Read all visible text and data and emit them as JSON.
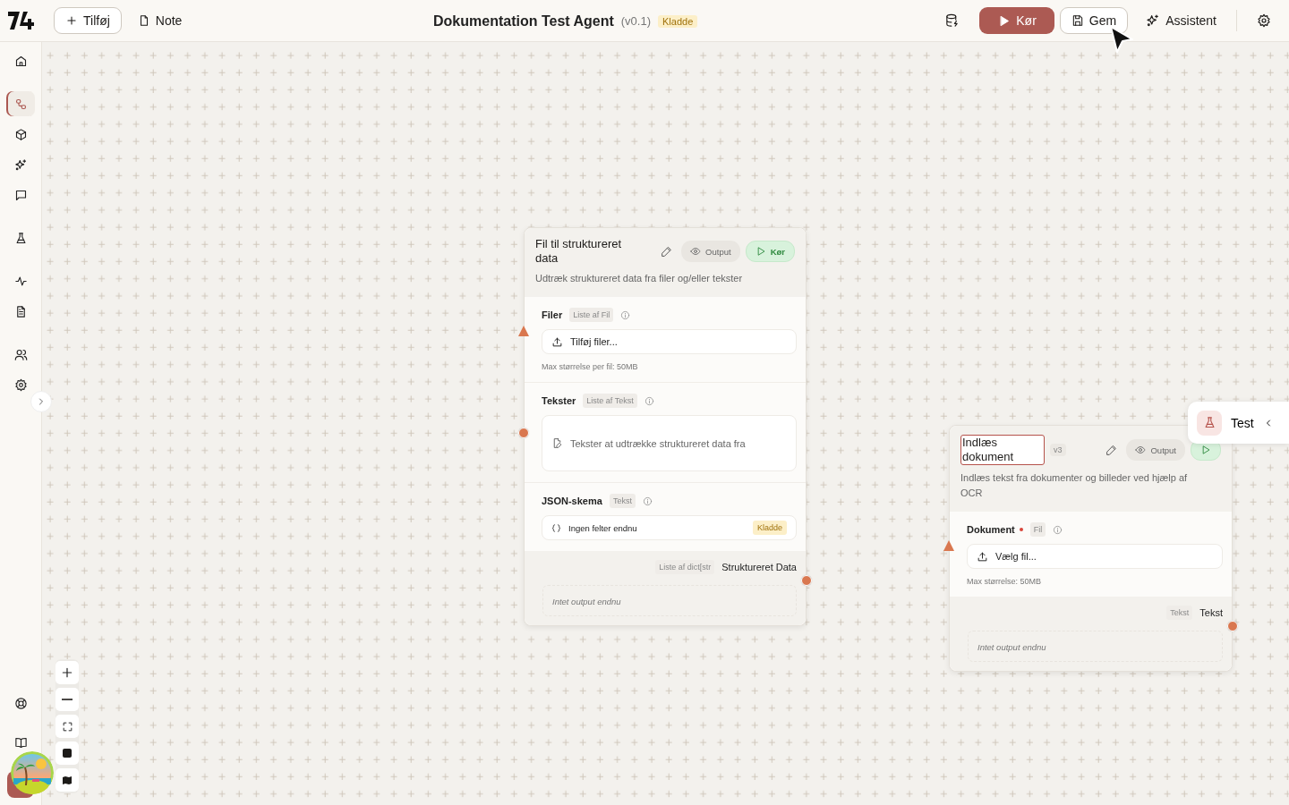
{
  "topbar": {
    "add_button": "Tilføj",
    "note_button": "Note",
    "title": "Dokumentation Test Agent",
    "version": "(v0.1)",
    "status_badge": "Kladde",
    "run_button": "Kør",
    "save_button": "Gem",
    "assistant_button": "Assistent"
  },
  "sidebar": {
    "items": [
      {
        "selected": false
      },
      {
        "selected": true
      },
      {
        "selected": false
      },
      {
        "selected": false
      },
      {
        "selected": false
      },
      {
        "selected": false
      },
      {
        "selected": false
      },
      {
        "selected": false
      },
      {
        "selected": false
      },
      {
        "selected": false
      }
    ]
  },
  "nodes": [
    {
      "title": "Fil til struktureret data",
      "editing": false,
      "description": "Udtræk struktureret data fra filer og/eller tekster",
      "output_button": "Output",
      "run_button": "Kør",
      "inputs": [
        {
          "kind": "upload",
          "label": "Filer",
          "required": false,
          "type": "Liste af Fil",
          "button": "Tilføj filer...",
          "hint": "Max størrelse per fil: 50MB"
        },
        {
          "kind": "text",
          "label": "Tekster",
          "required": false,
          "type": "Liste af Tekst",
          "placeholder": "Tekster at udtrække struktureret data fra"
        },
        {
          "kind": "schema",
          "label": "JSON-skema",
          "required": false,
          "type": "Tekst",
          "value": "Ingen felter endnu",
          "badge": "Kladde"
        }
      ],
      "output": {
        "type": "Liste af dict[str",
        "label": "Struktureret Data",
        "empty": "Intet output endnu"
      }
    },
    {
      "title": "Indlæs dokument",
      "editing": true,
      "version": "v3",
      "description": "Indlæs tekst fra dokumenter og billeder ved hjælp af OCR",
      "output_button": "Output",
      "inputs": [
        {
          "kind": "upload",
          "label": "Dokument",
          "required": true,
          "type": "Fil",
          "button": "Vælg fil...",
          "hint": "Max størrelse: 50MB"
        }
      ],
      "output": {
        "type": "Tekst",
        "label": "Tekst",
        "empty": "Intet output endnu"
      }
    }
  ],
  "test_panel": {
    "label": "Test"
  }
}
